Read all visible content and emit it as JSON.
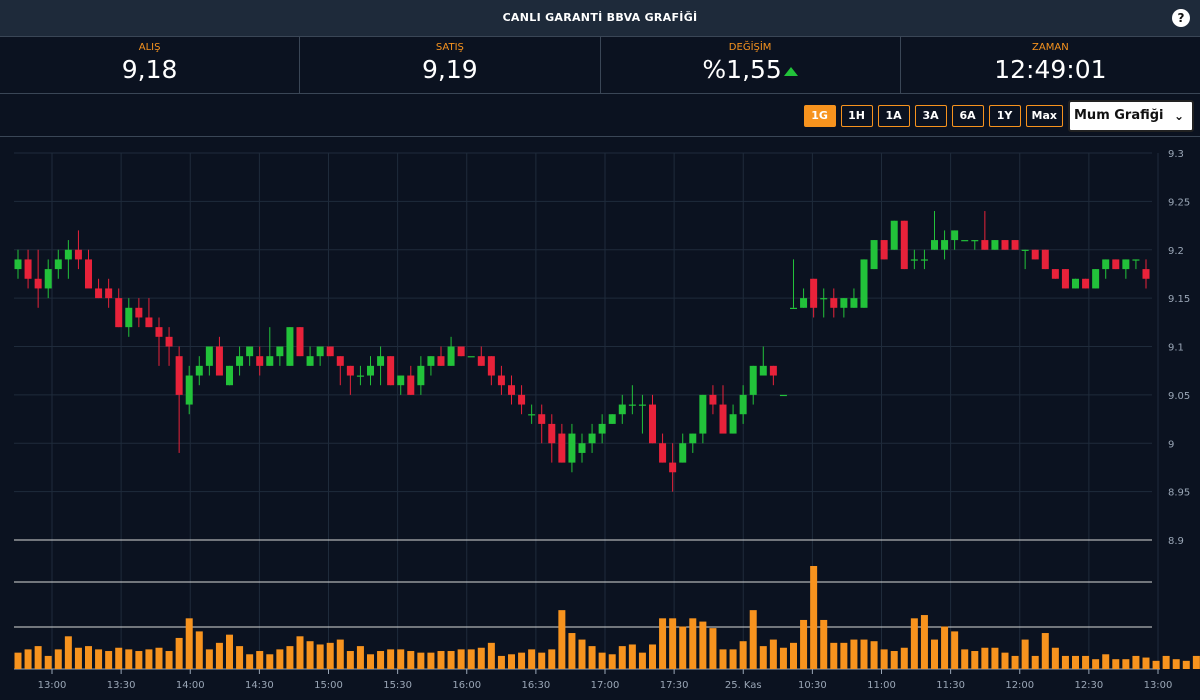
{
  "header": {
    "title": "CANLI GARANTİ BBVA GRAFİĞİ",
    "help_label": "?"
  },
  "stats": [
    {
      "label": "ALIŞ",
      "value": "9,18"
    },
    {
      "label": "SATIŞ",
      "value": "9,19"
    },
    {
      "label": "DEĞİŞİM",
      "value": "%1,55"
    },
    {
      "label": "ZAMAN",
      "value": "12:49:01"
    }
  ],
  "toolbar": {
    "ranges": [
      "1G",
      "1H",
      "1A",
      "3A",
      "6A",
      "1Y",
      "Max"
    ],
    "active_range": "1G",
    "chart_type_selected": "Mum Grafiği"
  },
  "colors": {
    "up": "#22c23a",
    "down": "#e8223a",
    "volume": "#f7931e",
    "accent": "#f7931e"
  },
  "chart_data": {
    "type": "candlestick",
    "y_ticks": [
      "9.3",
      "9.25",
      "9.2",
      "9.15",
      "9.1",
      "9.05",
      "9",
      "8.95",
      "8.9"
    ],
    "ylim": [
      8.9,
      9.3
    ],
    "x_ticks": [
      "13:00",
      "13:30",
      "14:00",
      "14:30",
      "15:00",
      "15:30",
      "16:00",
      "16:30",
      "17:00",
      "17:30",
      "25. Kas",
      "10:30",
      "11:00",
      "11:30",
      "12:00",
      "12:30",
      "13:00"
    ],
    "candles": [
      [
        9.18,
        9.2,
        9.17,
        9.19
      ],
      [
        9.19,
        9.2,
        9.16,
        9.17
      ],
      [
        9.17,
        9.2,
        9.14,
        9.16
      ],
      [
        9.16,
        9.19,
        9.15,
        9.18
      ],
      [
        9.18,
        9.2,
        9.17,
        9.19
      ],
      [
        9.19,
        9.21,
        9.17,
        9.2
      ],
      [
        9.2,
        9.22,
        9.18,
        9.19
      ],
      [
        9.19,
        9.2,
        9.17,
        9.16
      ],
      [
        9.16,
        9.17,
        9.15,
        9.15
      ],
      [
        9.16,
        9.17,
        9.14,
        9.15
      ],
      [
        9.15,
        9.16,
        9.12,
        9.12
      ],
      [
        9.12,
        9.15,
        9.11,
        9.14
      ],
      [
        9.14,
        9.15,
        9.12,
        9.13
      ],
      [
        9.13,
        9.15,
        9.12,
        9.12
      ],
      [
        9.12,
        9.13,
        9.08,
        9.11
      ],
      [
        9.11,
        9.12,
        9.08,
        9.1
      ],
      [
        9.09,
        9.1,
        8.99,
        9.05
      ],
      [
        9.04,
        9.08,
        9.03,
        9.07
      ],
      [
        9.07,
        9.09,
        9.06,
        9.08
      ],
      [
        9.08,
        9.1,
        9.07,
        9.1
      ],
      [
        9.1,
        9.11,
        9.07,
        9.07
      ],
      [
        9.06,
        9.08,
        9.06,
        9.08
      ],
      [
        9.08,
        9.1,
        9.07,
        9.09
      ],
      [
        9.09,
        9.1,
        9.08,
        9.1
      ],
      [
        9.09,
        9.1,
        9.07,
        9.08
      ],
      [
        9.08,
        9.12,
        9.08,
        9.09
      ],
      [
        9.09,
        9.1,
        9.08,
        9.1
      ],
      [
        9.08,
        9.12,
        9.08,
        9.12
      ],
      [
        9.12,
        9.12,
        9.09,
        9.09
      ],
      [
        9.08,
        9.1,
        9.08,
        9.09
      ],
      [
        9.09,
        9.1,
        9.08,
        9.1
      ],
      [
        9.1,
        9.1,
        9.09,
        9.09
      ],
      [
        9.09,
        9.09,
        9.06,
        9.08
      ],
      [
        9.08,
        9.08,
        9.05,
        9.07
      ],
      [
        9.07,
        9.08,
        9.06,
        9.07
      ],
      [
        9.07,
        9.09,
        9.06,
        9.08
      ],
      [
        9.08,
        9.1,
        9.06,
        9.09
      ],
      [
        9.09,
        9.09,
        9.06,
        9.06
      ],
      [
        9.06,
        9.07,
        9.05,
        9.07
      ],
      [
        9.07,
        9.08,
        9.05,
        9.05
      ],
      [
        9.06,
        9.09,
        9.05,
        9.08
      ],
      [
        9.08,
        9.09,
        9.07,
        9.09
      ],
      [
        9.09,
        9.1,
        9.08,
        9.08
      ],
      [
        9.08,
        9.11,
        9.08,
        9.1
      ],
      [
        9.1,
        9.1,
        9.09,
        9.09
      ],
      [
        9.09,
        9.09,
        9.09,
        9.09
      ],
      [
        9.09,
        9.1,
        9.08,
        9.08
      ],
      [
        9.09,
        9.09,
        9.06,
        9.07
      ],
      [
        9.07,
        9.08,
        9.05,
        9.06
      ],
      [
        9.06,
        9.07,
        9.04,
        9.05
      ],
      [
        9.05,
        9.06,
        9.03,
        9.04
      ],
      [
        9.03,
        9.04,
        9.02,
        9.03
      ],
      [
        9.03,
        9.04,
        9.0,
        9.02
      ],
      [
        9.02,
        9.03,
        8.98,
        9.0
      ],
      [
        9.01,
        9.02,
        8.98,
        8.98
      ],
      [
        8.98,
        9.02,
        8.97,
        9.01
      ],
      [
        8.99,
        9.01,
        8.98,
        9.0
      ],
      [
        9.0,
        9.02,
        8.99,
        9.01
      ],
      [
        9.01,
        9.03,
        9.0,
        9.02
      ],
      [
        9.02,
        9.03,
        9.02,
        9.03
      ],
      [
        9.03,
        9.05,
        9.02,
        9.04
      ],
      [
        9.04,
        9.06,
        9.03,
        9.04
      ],
      [
        9.04,
        9.05,
        9.01,
        9.04
      ],
      [
        9.04,
        9.05,
        9.0,
        9.0
      ],
      [
        9.0,
        9.01,
        8.98,
        8.98
      ],
      [
        8.98,
        9.0,
        8.95,
        8.97
      ],
      [
        8.98,
        9.01,
        8.98,
        9.0
      ],
      [
        9.0,
        9.01,
        8.99,
        9.01
      ],
      [
        9.01,
        9.05,
        9.0,
        9.05
      ],
      [
        9.05,
        9.06,
        9.03,
        9.04
      ],
      [
        9.04,
        9.06,
        9.03,
        9.01
      ],
      [
        9.01,
        9.04,
        9.01,
        9.03
      ],
      [
        9.03,
        9.06,
        9.02,
        9.05
      ],
      [
        9.05,
        9.08,
        9.04,
        9.08
      ],
      [
        9.07,
        9.1,
        9.07,
        9.08
      ],
      [
        9.08,
        9.08,
        9.06,
        9.07
      ],
      [
        9.05,
        9.05,
        9.05,
        9.05
      ],
      [
        9.14,
        9.19,
        9.14,
        9.14
      ],
      [
        9.14,
        9.16,
        9.14,
        9.15
      ],
      [
        9.17,
        9.17,
        9.13,
        9.14
      ],
      [
        9.15,
        9.16,
        9.13,
        9.15
      ],
      [
        9.15,
        9.16,
        9.13,
        9.14
      ],
      [
        9.14,
        9.15,
        9.13,
        9.15
      ],
      [
        9.14,
        9.16,
        9.14,
        9.15
      ],
      [
        9.14,
        9.19,
        9.14,
        9.19
      ],
      [
        9.18,
        9.21,
        9.18,
        9.21
      ],
      [
        9.21,
        9.21,
        9.19,
        9.19
      ],
      [
        9.2,
        9.23,
        9.2,
        9.23
      ],
      [
        9.23,
        9.23,
        9.18,
        9.18
      ],
      [
        9.19,
        9.2,
        9.18,
        9.19
      ],
      [
        9.19,
        9.2,
        9.18,
        9.19
      ],
      [
        9.2,
        9.24,
        9.2,
        9.21
      ],
      [
        9.2,
        9.22,
        9.19,
        9.21
      ],
      [
        9.21,
        9.22,
        9.2,
        9.22
      ],
      [
        9.21,
        9.21,
        9.21,
        9.21
      ],
      [
        9.21,
        9.21,
        9.2,
        9.21
      ],
      [
        9.21,
        9.24,
        9.2,
        9.2
      ],
      [
        9.2,
        9.21,
        9.2,
        9.21
      ],
      [
        9.21,
        9.21,
        9.2,
        9.2
      ],
      [
        9.21,
        9.21,
        9.2,
        9.2
      ],
      [
        9.2,
        9.2,
        9.18,
        9.2
      ],
      [
        9.2,
        9.2,
        9.19,
        9.19
      ],
      [
        9.2,
        9.2,
        9.18,
        9.18
      ],
      [
        9.18,
        9.18,
        9.17,
        9.17
      ],
      [
        9.18,
        9.18,
        9.16,
        9.16
      ],
      [
        9.16,
        9.17,
        9.16,
        9.17
      ],
      [
        9.17,
        9.17,
        9.16,
        9.16
      ],
      [
        9.16,
        9.18,
        9.16,
        9.18
      ],
      [
        9.18,
        9.19,
        9.17,
        9.19
      ],
      [
        9.19,
        9.19,
        9.18,
        9.18
      ],
      [
        9.18,
        9.19,
        9.17,
        9.19
      ],
      [
        9.19,
        9.19,
        9.18,
        9.19
      ],
      [
        9.18,
        9.19,
        9.16,
        9.17
      ]
    ],
    "volume": [
      1,
      1.2,
      1.4,
      0.8,
      1.2,
      2,
      1.3,
      1.4,
      1.2,
      1.1,
      1.3,
      1.2,
      1.1,
      1.2,
      1.3,
      1.1,
      1.9,
      3.1,
      2.3,
      1.2,
      1.6,
      2.1,
      1.4,
      0.9,
      1.1,
      0.9,
      1.2,
      1.4,
      2,
      1.7,
      1.5,
      1.6,
      1.8,
      1.1,
      1.4,
      0.9,
      1.1,
      1.2,
      1.2,
      1.1,
      1,
      1,
      1.1,
      1.1,
      1.2,
      1.2,
      1.3,
      1.6,
      0.8,
      0.9,
      1,
      1.2,
      1,
      1.2,
      3.6,
      2.2,
      1.8,
      1.4,
      1,
      0.9,
      1.4,
      1.5,
      1,
      1.5,
      3.1,
      3.1,
      2.6,
      3.1,
      2.9,
      2.5,
      1.2,
      1.2,
      1.7,
      3.6,
      1.4,
      1.8,
      1.3,
      1.6,
      3,
      6.3,
      3,
      1.6,
      1.6,
      1.8,
      1.8,
      1.7,
      1.2,
      1.1,
      1.3,
      3.1,
      3.3,
      1.8,
      2.6,
      2.3,
      1.2,
      1.1,
      1.3,
      1.3,
      1,
      0.8,
      1.8,
      0.8,
      2.2,
      1.3,
      0.8,
      0.8,
      0.8,
      0.6,
      0.9,
      0.6,
      0.6,
      0.8,
      0.7,
      0.5,
      0.8,
      0.6,
      0.5,
      0.8,
      0.6,
      0.6
    ]
  }
}
